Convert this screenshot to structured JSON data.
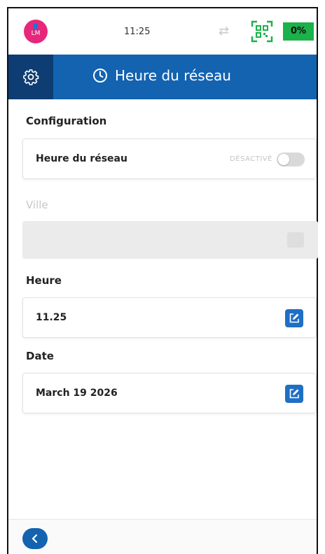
{
  "statusbar": {
    "avatar_text": "LM",
    "time": "11:25",
    "battery": "0%"
  },
  "header": {
    "title": "Heure du réseau"
  },
  "configuration": {
    "label": "Configuration",
    "network_time_label": "Heure du réseau",
    "toggle_state": "DÉSACTIVÉ"
  },
  "ville": {
    "label": "Ville",
    "value": ""
  },
  "heure": {
    "label": "Heure",
    "value": "11.25"
  },
  "date": {
    "label": "Date",
    "value": "March 19 2026"
  },
  "colors": {
    "primary": "#1363b0",
    "primary_dark": "#0d3d72",
    "battery": "#1bb14b",
    "avatar": "#e6277b"
  }
}
